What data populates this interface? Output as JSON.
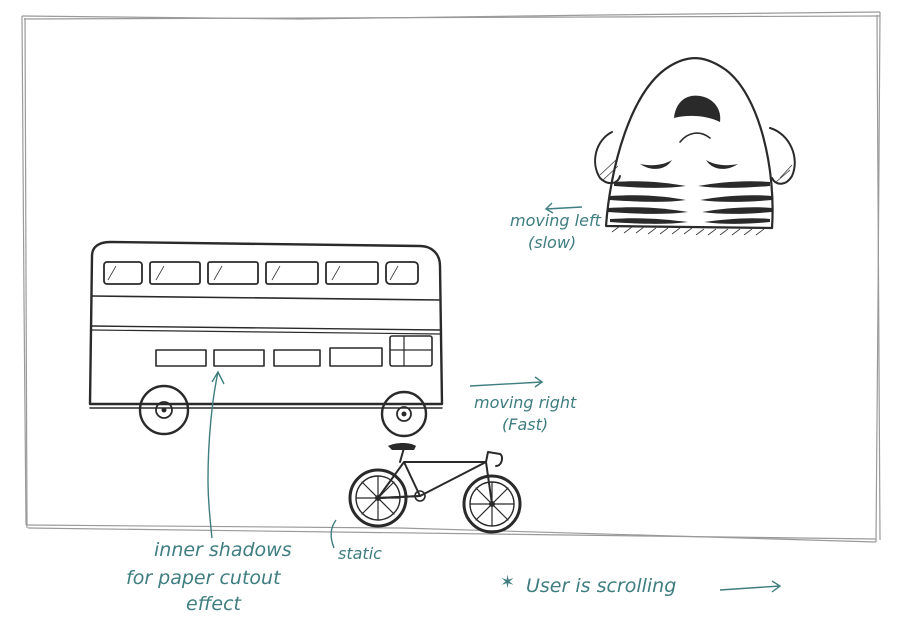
{
  "annotations": {
    "moving_left_1": "moving left",
    "moving_left_2": "(slow)",
    "moving_right_1": "moving right",
    "moving_right_2": "(Fast)",
    "inner_shadows_1": "inner shadows",
    "inner_shadows_2": "for paper cutout",
    "inner_shadows_3": "effect",
    "static": "static",
    "user_scrolling": "User is scrolling"
  },
  "colors": {
    "ink": "#2a2a2a",
    "annotation": "#3f7d80",
    "frame": "#9a9a9a"
  },
  "icons": {
    "star": "star-icon",
    "arrow_right": "arrow-right-icon",
    "arrow_left": "arrow-left-icon"
  }
}
